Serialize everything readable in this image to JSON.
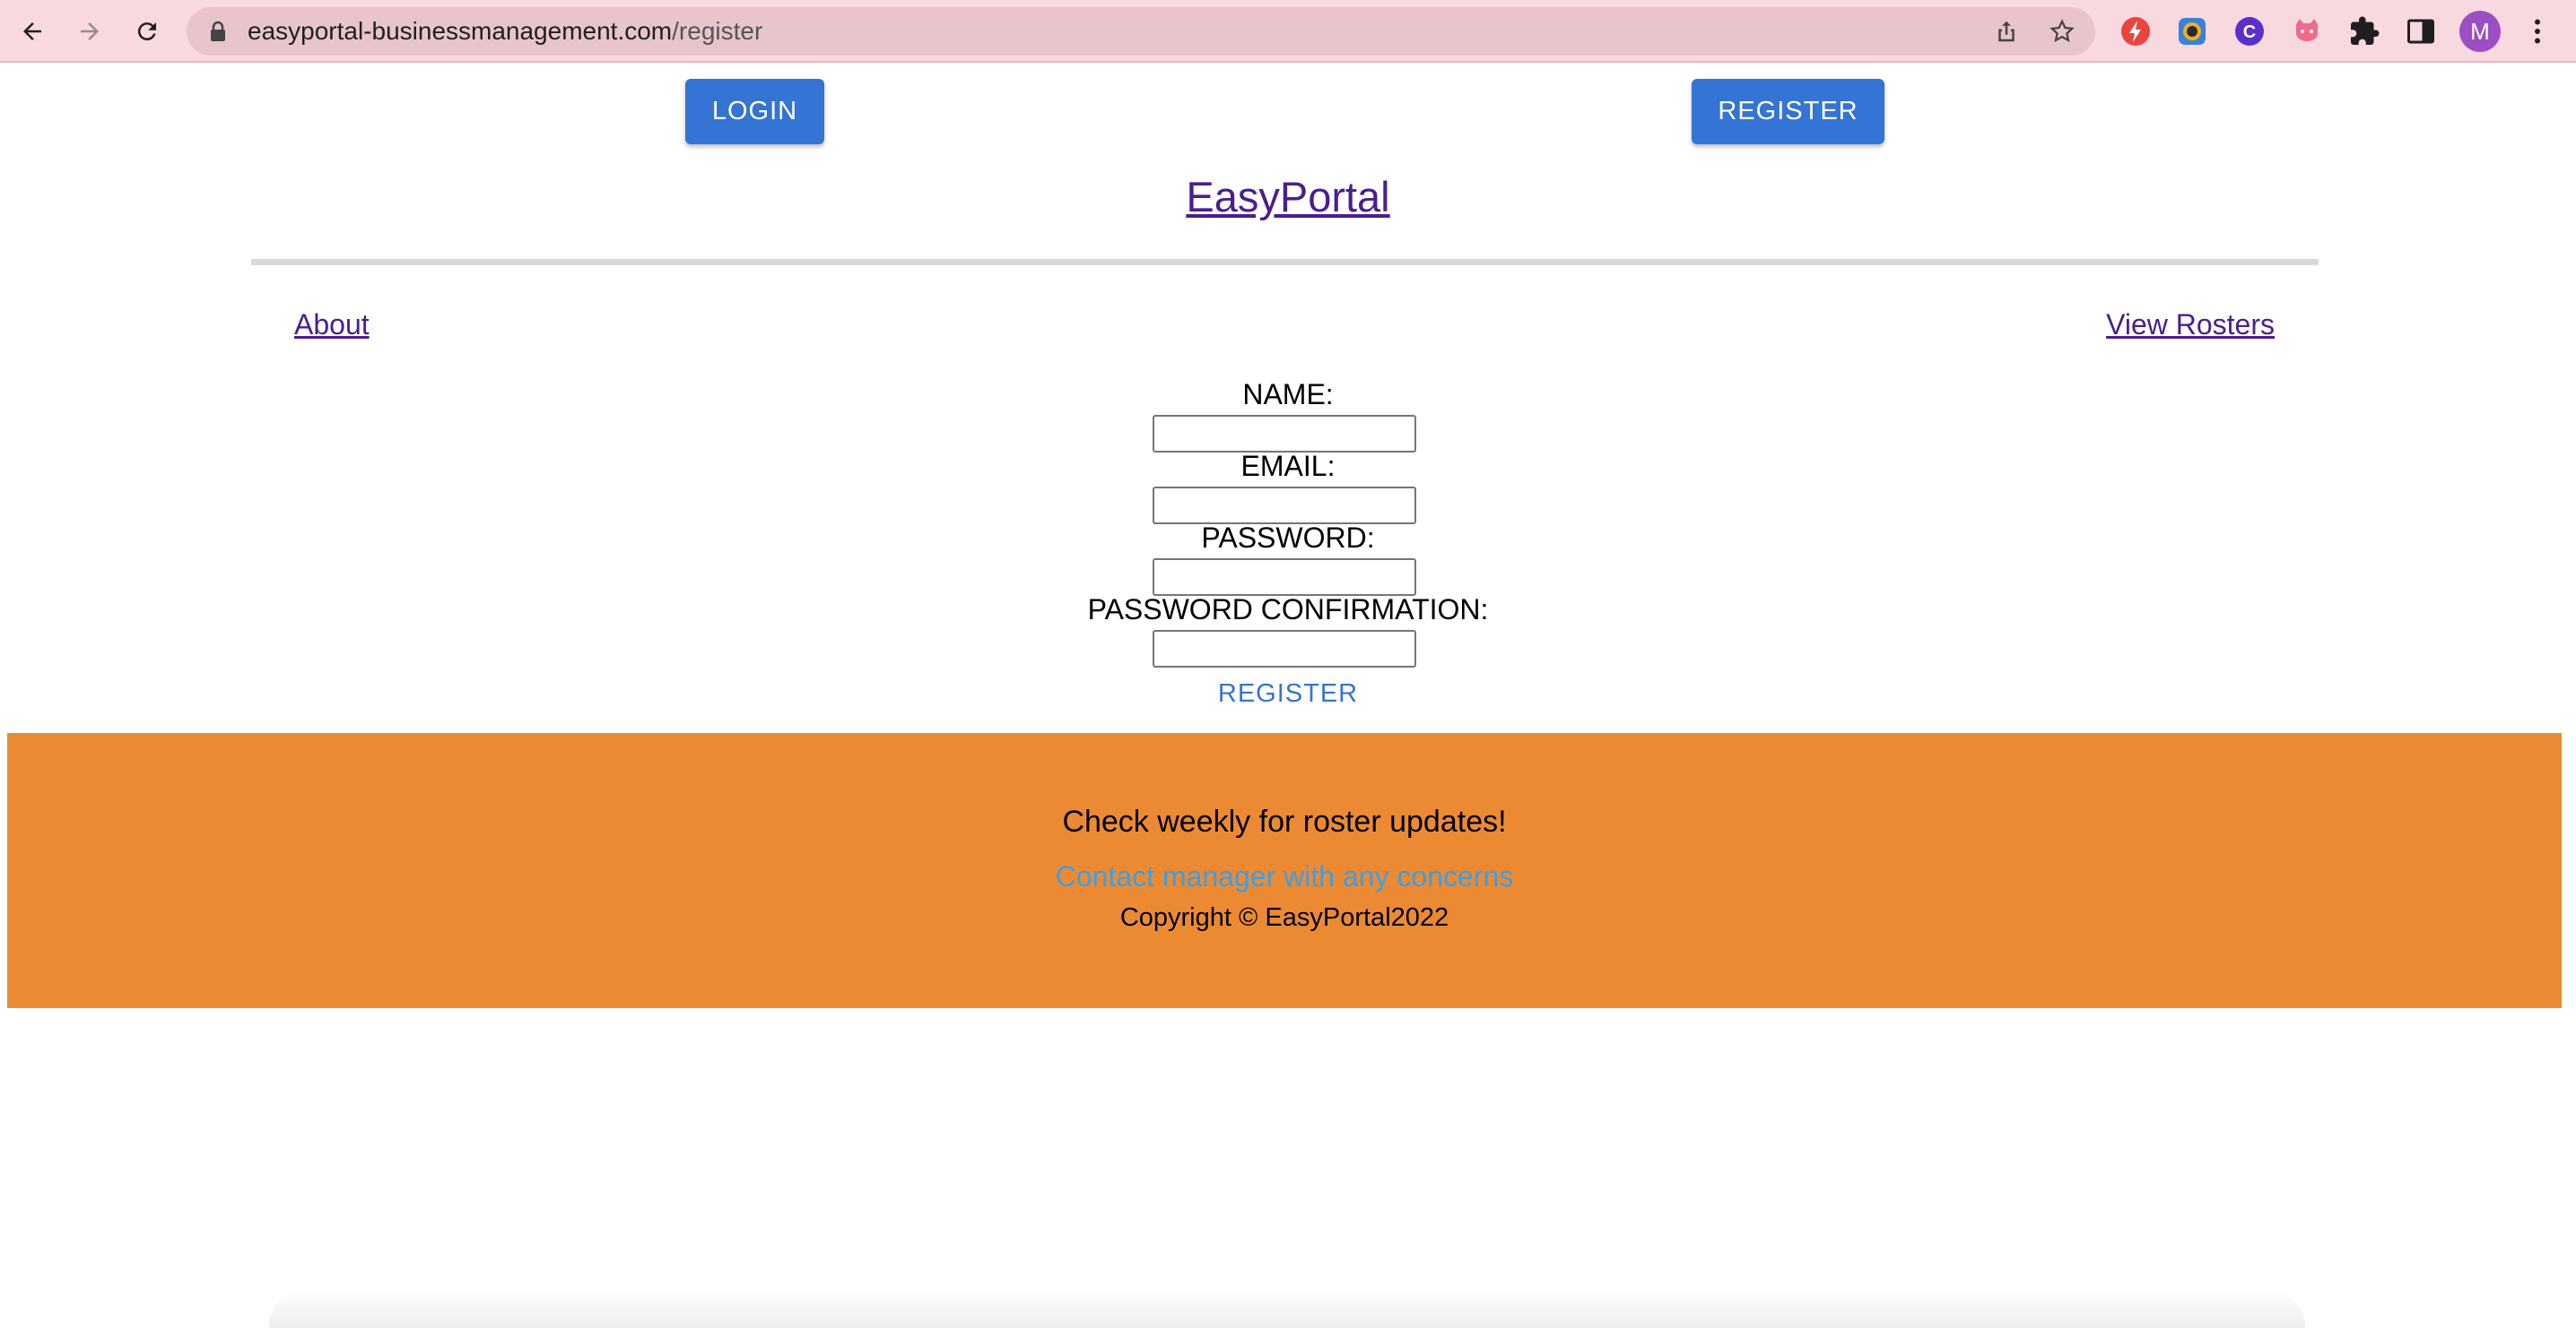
{
  "browser": {
    "url_host": "easyportal-businessmanagement.com",
    "url_path": "/register",
    "avatar_initial": "M"
  },
  "header": {
    "login_label": "LOGIN",
    "register_label": "REGISTER",
    "brand": "EasyPortal"
  },
  "nav": {
    "about": "About",
    "view_rosters": "View Rosters"
  },
  "form": {
    "name_label": "NAME:",
    "email_label": "EMAIL:",
    "password_label": "PASSWORD:",
    "password_confirmation_label": "PASSWORD CONFIRMATION:",
    "name_value": "",
    "email_value": "",
    "password_value": "",
    "password_confirmation_value": "",
    "submit_label": "REGISTER"
  },
  "footer": {
    "updates": "Check weekly for roster updates!",
    "contact": "Contact manager with any concerns",
    "copyright": "Copyright © EasyPortal2022"
  },
  "colors": {
    "button_blue": "#3474d4",
    "link_purple": "#4b1e8e",
    "footer_orange": "#ec8a33",
    "contact_blue": "#3a9fe6",
    "chrome_pink": "#f9d9e0"
  }
}
